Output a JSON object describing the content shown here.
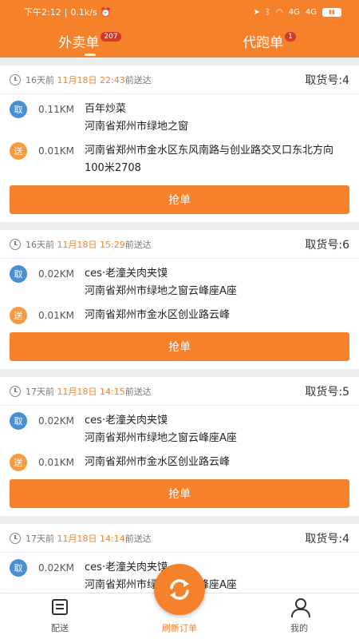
{
  "status_bar": {
    "time": "下午2:12",
    "speed": "0.1k/s",
    "signal1": "4G",
    "signal2": "4G"
  },
  "tabs": [
    {
      "label": "外卖单",
      "badge": "207"
    },
    {
      "label": "代跑单",
      "badge": "1"
    }
  ],
  "orders": [
    {
      "days": "16天前",
      "date": "11月18日",
      "time": "22:43",
      "suffix": "前送达",
      "pickup_no": "取货号:4",
      "pickup_dist": "0.11KM",
      "pickup_name": "百年炒菜",
      "pickup_addr": "河南省郑州市绿地之窗",
      "deliver_dist": "0.01KM",
      "deliver_addr": "河南省郑州市金水区东风南路与创业路交叉口东北方向100米2708",
      "button": "抢单"
    },
    {
      "days": "16天前",
      "date": "11月18日",
      "time": "15:29",
      "suffix": "前送达",
      "pickup_no": "取货号:6",
      "pickup_dist": "0.02KM",
      "pickup_name": "ces·老潼关肉夹馍",
      "pickup_addr": "河南省郑州市绿地之窗云峰座A座",
      "deliver_dist": "0.01KM",
      "deliver_addr": "河南省郑州市金水区创业路云峰",
      "button": "抢单"
    },
    {
      "days": "17天前",
      "date": "11月18日",
      "time": "14:15",
      "suffix": "前送达",
      "pickup_no": "取货号:5",
      "pickup_dist": "0.02KM",
      "pickup_name": "ces·老潼关肉夹馍",
      "pickup_addr": "河南省郑州市绿地之窗云峰座A座",
      "deliver_dist": "0.01KM",
      "deliver_addr": "河南省郑州市金水区创业路云峰",
      "button": "抢单"
    },
    {
      "days": "17天前",
      "date": "11月18日",
      "time": "14:14",
      "suffix": "前送达",
      "pickup_no": "取货号:4",
      "pickup_dist": "0.02KM",
      "pickup_name": "ces·老潼关肉夹馍",
      "pickup_addr": "河南省郑州市绿地之窗云峰座A座"
    }
  ],
  "labels": {
    "pickup_tag": "取",
    "deliver_tag": "送"
  },
  "bottom_nav": {
    "left": "配送",
    "center": "刷新订单",
    "right": "我的"
  },
  "colors": {
    "accent": "#f5812a",
    "pickup_tag": "#4a8fd6",
    "deliver_tag": "#f59c40",
    "badge": "#d23a2a"
  },
  "icons": [
    "clock-icon",
    "refresh-icon",
    "delivery-list-icon",
    "user-icon",
    "location-icon",
    "bluetooth-icon",
    "wifi-icon",
    "alarm-icon",
    "battery-icon"
  ]
}
